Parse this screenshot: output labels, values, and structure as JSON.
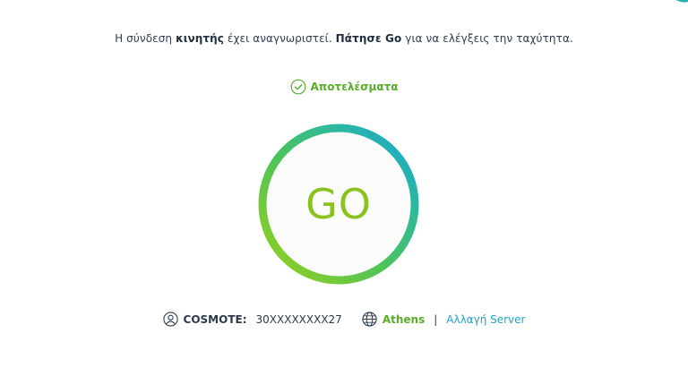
{
  "intro": {
    "part1": "Η σύνδεση ",
    "bold1": "κινητής",
    "part2": " έχει αναγνωριστεί. ",
    "bold2": "Πάτησε Go",
    "part3": " για να ελέγξεις την ταχύτητα."
  },
  "results": {
    "label": "Αποτελέσματα",
    "icon": "check-circle-icon"
  },
  "go_button": {
    "label": "GO"
  },
  "provider": {
    "icon": "user-icon",
    "name": "COSMOTE:",
    "number": "30XXXXXXXX27"
  },
  "server": {
    "icon": "globe-icon",
    "city": "Athens",
    "separator": "|",
    "change_label": "Αλλαγή Server"
  },
  "colors": {
    "green": "#5aac2b",
    "lime": "#8cc21f",
    "blue": "#1fa3c9",
    "text": "#2b3a4a"
  }
}
